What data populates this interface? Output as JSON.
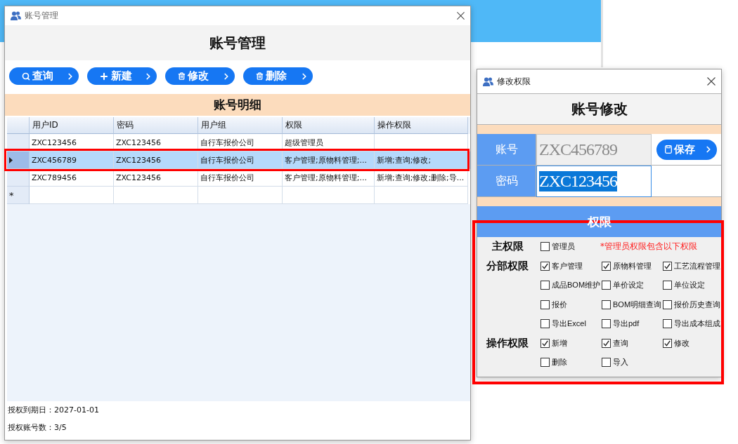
{
  "main_window": {
    "title": "账号管理",
    "heading": "账号管理",
    "toolbar": [
      {
        "kind": "search",
        "label": "查询"
      },
      {
        "kind": "plus",
        "label": "新建"
      },
      {
        "kind": "trash",
        "label": "修改"
      },
      {
        "kind": "trash",
        "label": "删除"
      }
    ],
    "section_title": "账号明细",
    "table": {
      "columns": [
        "用户ID",
        "密码",
        "用户组",
        "权限",
        "操作权限"
      ],
      "rows": [
        {
          "selected": false,
          "cells": [
            "ZXC123456",
            "ZXC123456",
            "自行车报价公司",
            "超级管理员"
          ]
        },
        {
          "selected": true,
          "cells": [
            "ZXC456789",
            "ZXC123456",
            "自行车报价公司",
            "客户管理;原物料管理;...",
            "新增;查询;修改;"
          ]
        },
        {
          "selected": false,
          "cells": [
            "ZXC789456",
            "ZXC123456",
            "自行车报价公司",
            "客户管理;原物料管理;...",
            "新增;查询;修改;删除;导..."
          ]
        }
      ],
      "new_row_marker": "*"
    },
    "footer": [
      "授权到期日：2027-01-01",
      "授权账号数：3/5"
    ]
  },
  "edit_dialog": {
    "title": "修改权限",
    "heading": "账号修改",
    "fields": [
      {
        "label": "账号",
        "value": "ZXC456789",
        "disabled": true,
        "focused": false
      },
      {
        "label": "密码",
        "value": "ZXC123456",
        "disabled": false,
        "focused": true
      }
    ],
    "save_button": "保存",
    "permissions_title": "权限",
    "permission_groups": [
      {
        "label": "主权限",
        "note": "*管理员权限包含以下权限",
        "options": [
          {
            "label": "管理员",
            "checked": false
          }
        ]
      },
      {
        "label": "分部权限",
        "options": [
          {
            "label": "客户管理",
            "checked": true
          },
          {
            "label": "原物料管理",
            "checked": true
          },
          {
            "label": "工艺流程管理",
            "checked": true
          },
          {
            "label": "成品BOM维护",
            "checked": false
          },
          {
            "label": "单价设定",
            "checked": false
          },
          {
            "label": "单位设定",
            "checked": false
          },
          {
            "label": "报价",
            "checked": false
          },
          {
            "label": "BOM明细查询",
            "checked": false
          },
          {
            "label": "报价历史查询",
            "checked": false
          },
          {
            "label": "导出Excel",
            "checked": false
          },
          {
            "label": "导出pdf",
            "checked": false
          },
          {
            "label": "导出成本组成",
            "checked": false
          }
        ]
      },
      {
        "label": "操作权限",
        "options": [
          {
            "label": "新增",
            "checked": true
          },
          {
            "label": "查询",
            "checked": true
          },
          {
            "label": "修改",
            "checked": true
          },
          {
            "label": "删除",
            "checked": false
          },
          {
            "label": "导入",
            "checked": false
          }
        ]
      }
    ]
  }
}
